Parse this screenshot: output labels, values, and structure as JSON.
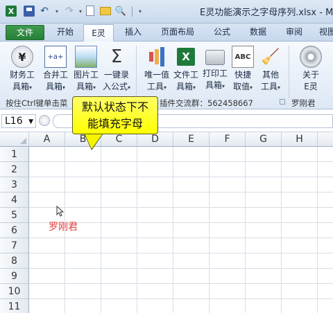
{
  "window": {
    "title": "E灵功能演示之字母序列.xlsx - Micro"
  },
  "tabs": [
    {
      "label": "文件"
    },
    {
      "label": "开始"
    },
    {
      "label": "E灵"
    },
    {
      "label": "插入"
    },
    {
      "label": "页面布局"
    },
    {
      "label": "公式"
    },
    {
      "label": "数据"
    },
    {
      "label": "审阅"
    },
    {
      "label": "视图"
    }
  ],
  "ribbon": {
    "buttons": [
      {
        "line1": "财务工",
        "line2": "具箱",
        "icon": "yen-icon"
      },
      {
        "line1": "合并工",
        "line2": "具箱",
        "icon": "merge-icon"
      },
      {
        "line1": "图片工",
        "line2": "具箱",
        "icon": "picture-icon"
      },
      {
        "line1": "一键录",
        "line2": "入公式",
        "icon": "sigma-icon"
      },
      {
        "line1": "唯一值",
        "line2": "工具",
        "icon": "bar-chart-icon"
      },
      {
        "line1": "文件工",
        "line2": "具箱",
        "icon": "excel-icon"
      },
      {
        "line1": "打印工",
        "line2": "具箱",
        "icon": "printer-icon"
      },
      {
        "line1": "快捷",
        "line2": "取值",
        "icon": "abc-icon"
      },
      {
        "line1": "其他",
        "line2": "工具",
        "icon": "broom-icon"
      },
      {
        "line1": "关于",
        "line2": "E灵",
        "icon": "disc-icon"
      }
    ],
    "caret": "▾",
    "status_left": "按住Ctrl键单击菜",
    "status_mid": "插件交流群：562458667",
    "status_right": "罗刚君"
  },
  "formula_bar": {
    "name_box": "L16",
    "formula": ""
  },
  "grid": {
    "columns": [
      "A",
      "B",
      "C",
      "D",
      "E",
      "F",
      "G",
      "H"
    ],
    "rows": [
      "1",
      "2",
      "3",
      "4",
      "5",
      "6",
      "7",
      "8",
      "9",
      "10",
      "11"
    ],
    "cell_A6": "罗刚君"
  },
  "callout": {
    "line1": "默认状态下不",
    "line2": "能填充字母"
  },
  "colors": {
    "file_tab": "#26803a",
    "callout": "#ffff00",
    "cell_text": "#e83a3a"
  }
}
